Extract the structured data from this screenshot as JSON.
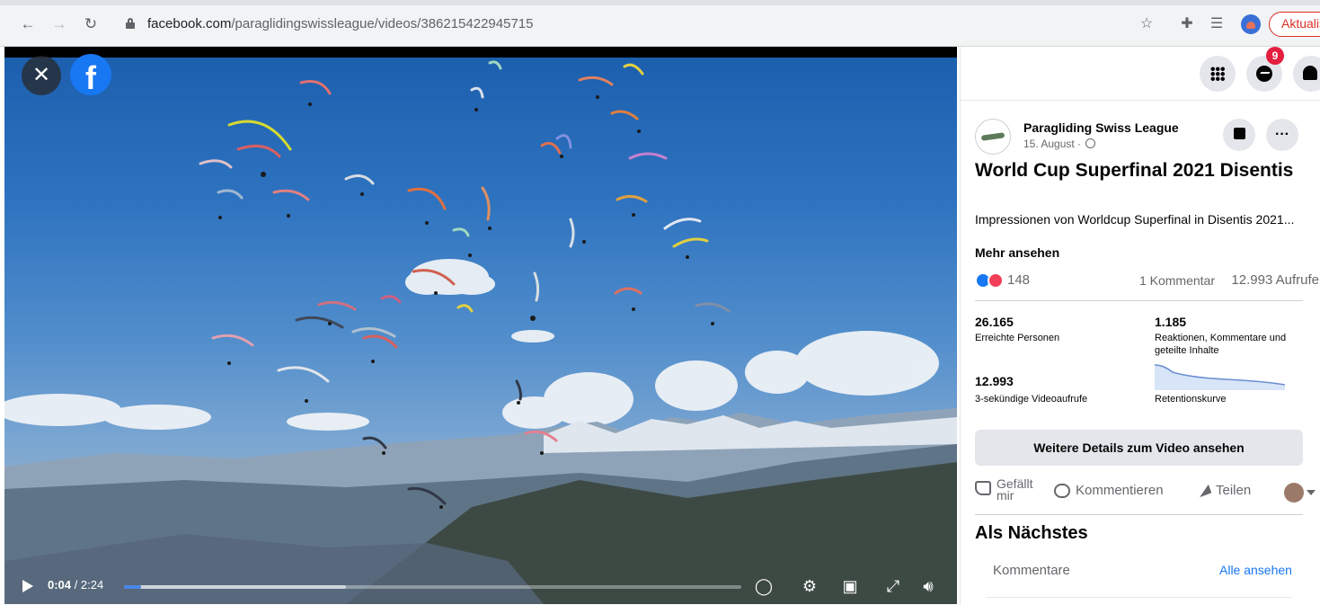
{
  "browser": {
    "url_domain": "facebook.com",
    "url_path": "/paraglidingswissleague/videos/386215422945715",
    "update_label": "Aktualisieren"
  },
  "player": {
    "current_time": "0:04",
    "duration": "/ 2:24",
    "progress_fraction": 0.028,
    "buffered_fraction": 0.36
  },
  "header": {
    "notification_count": "9"
  },
  "post": {
    "page_name": "Paragliding Swiss League",
    "date": "15. August ·",
    "title": "World Cup Superfinal 2021 Disentis",
    "description": "Impressionen von Worldcup Superfinal in Disentis 2021...",
    "more_link": "Mehr ansehen",
    "reaction_count": "148",
    "comment_count": "1 Kommentar",
    "view_count": "12.993 Aufrufe"
  },
  "insights": {
    "reach_value": "26.165",
    "reach_label": "Erreichte Personen",
    "engagement_value": "1.185",
    "engagement_label": "Reaktionen, Kommentare und geteilte Inhalte",
    "views_value": "12.993",
    "views_label": "3-sekündige Videoaufrufe",
    "retention_label": "Retentionskurve"
  },
  "actions": {
    "details_button": "Weitere Details zum Video ansehen",
    "like": "Gefällt mir",
    "comment": "Kommentieren",
    "share": "Teilen"
  },
  "next": {
    "title": "Als Nächstes",
    "comments_tab": "Kommentare",
    "see_all": "Alle ansehen"
  },
  "colors": {
    "facebook_blue": "#1877f2",
    "badge_red": "#e41e3f",
    "progress_blue": "#4a86e8"
  }
}
